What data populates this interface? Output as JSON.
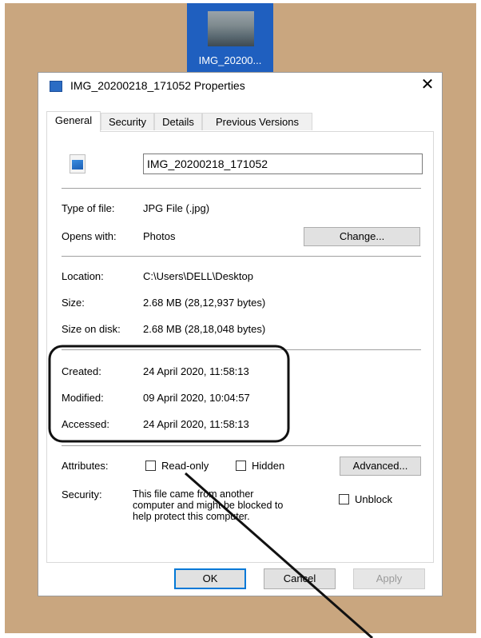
{
  "desktop": {
    "icon_label": "IMG_20200..."
  },
  "dialog": {
    "title": "IMG_20200218_171052 Properties",
    "close_glyph": "✕",
    "tabs": [
      {
        "label": "General"
      },
      {
        "label": "Security"
      },
      {
        "label": "Details"
      },
      {
        "label": "Previous Versions"
      }
    ],
    "active_tab": "General",
    "file_name_value": "IMG_20200218_171052",
    "type_of_file": {
      "label": "Type of file:",
      "value": "JPG File (.jpg)"
    },
    "opens_with": {
      "label": "Opens with:",
      "value": "Photos",
      "button": "Change..."
    },
    "location": {
      "label": "Location:",
      "value": "C:\\Users\\DELL\\Desktop"
    },
    "size": {
      "label": "Size:",
      "value": "2.68 MB (28,12,937 bytes)"
    },
    "size_on_disk": {
      "label": "Size on disk:",
      "value": "2.68 MB (28,18,048 bytes)"
    },
    "created": {
      "label": "Created:",
      "value": "24 April 2020, 11:58:13"
    },
    "modified": {
      "label": "Modified:",
      "value": "09 April 2020, 10:04:57"
    },
    "accessed": {
      "label": "Accessed:",
      "value": "24 April 2020, 11:58:13"
    },
    "attributes": {
      "label": "Attributes:",
      "read_only": "Read-only",
      "hidden": "Hidden",
      "advanced_button": "Advanced..."
    },
    "security": {
      "label": "Security:",
      "lines": [
        "This file came from another",
        "computer and might be blocked to",
        "help protect this computer."
      ],
      "unblock": "Unblock"
    },
    "buttons": {
      "ok": "OK",
      "cancel": "Cancel",
      "apply": "Apply"
    }
  },
  "colors": {
    "desktop_background": "#c9a67f",
    "selection_blue": "#1f5fbf",
    "annotation": "#111111"
  }
}
